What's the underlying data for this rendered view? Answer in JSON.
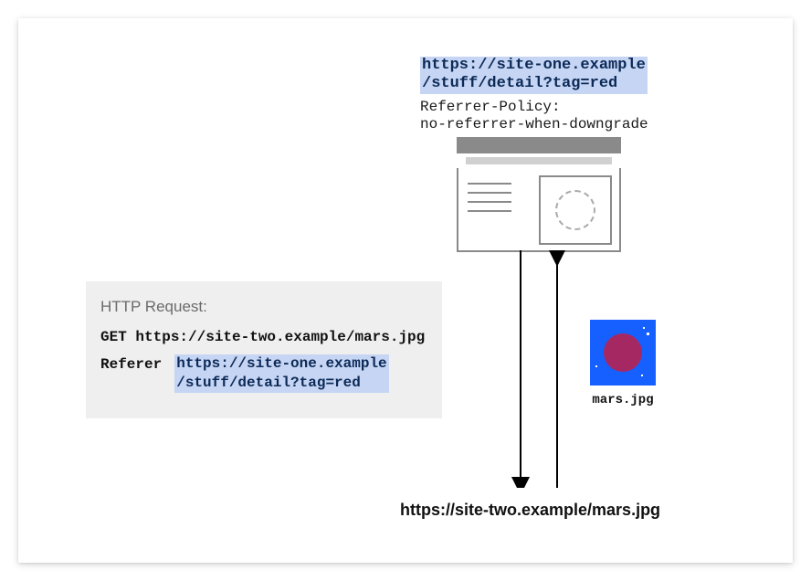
{
  "origin_url": "https://site-one.example\n/stuff/detail?tag=red",
  "referrer_policy_line": "Referrer-Policy:\nno-referrer-when-downgrade",
  "http_request": {
    "label": "HTTP Request:",
    "get_line": "GET https://site-two.example/mars.jpg",
    "referer_label": "Referer",
    "referer_value": "https://site-one.example\n/stuff/detail?tag=red"
  },
  "mars_filename": "mars.jpg",
  "destination_url": "https://site-two.example/mars.jpg"
}
